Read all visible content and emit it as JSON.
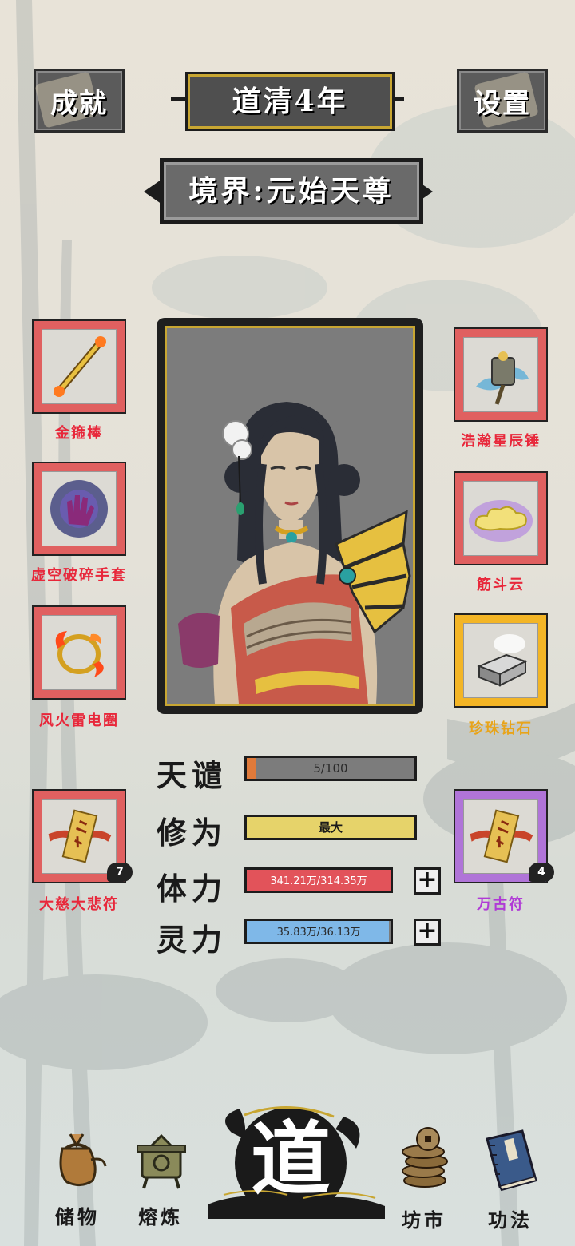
{
  "header": {
    "achievement_label": "成就",
    "year_label": "道清4年",
    "settings_label": "设置",
    "realm_label": "境界:元始天尊"
  },
  "equipment_left": [
    {
      "name": "金箍棒",
      "rarity": "red",
      "icon": "golden-staff-icon"
    },
    {
      "name": "虚空破碎手套",
      "rarity": "red",
      "icon": "void-glove-icon"
    },
    {
      "name": "风火雷电圈",
      "rarity": "red",
      "icon": "fire-ring-icon"
    },
    {
      "name": "大慈大悲符",
      "rarity": "red",
      "icon": "talisman-icon",
      "count": "7"
    }
  ],
  "equipment_right": [
    {
      "name": "浩瀚星辰锤",
      "rarity": "red",
      "icon": "star-hammer-icon"
    },
    {
      "name": "筋斗云",
      "rarity": "red",
      "icon": "cloud-icon"
    },
    {
      "name": "珍珠钻石",
      "rarity": "gold",
      "icon": "diamond-box-icon"
    },
    {
      "name": "万古符",
      "rarity": "purple",
      "icon": "talisman-icon",
      "count": "4"
    }
  ],
  "stats": {
    "tianqian": {
      "label": "天谴",
      "text": "5/100",
      "fill": 0.05,
      "color": "#e07a3a"
    },
    "xiuwei": {
      "label": "修为",
      "text": "最大",
      "fill": 1.0,
      "color": "#e6d36a"
    },
    "tili": {
      "label": "体力",
      "text": "341.21万/314.35万",
      "fill": 1.0,
      "color": "#e2535a"
    },
    "lingli": {
      "label": "灵力",
      "text": "35.83万/36.13万",
      "fill": 0.99,
      "color": "#7fb8e8"
    },
    "plus": "+"
  },
  "nav": {
    "storage": "储物",
    "smelt": "熔炼",
    "dao": "道",
    "market": "坊市",
    "skills": "功法"
  },
  "colors": {
    "slot_red": "#e06060",
    "slot_gold": "#f3b526",
    "slot_purple": "#b074d8",
    "frame_gold": "#c8a632"
  }
}
